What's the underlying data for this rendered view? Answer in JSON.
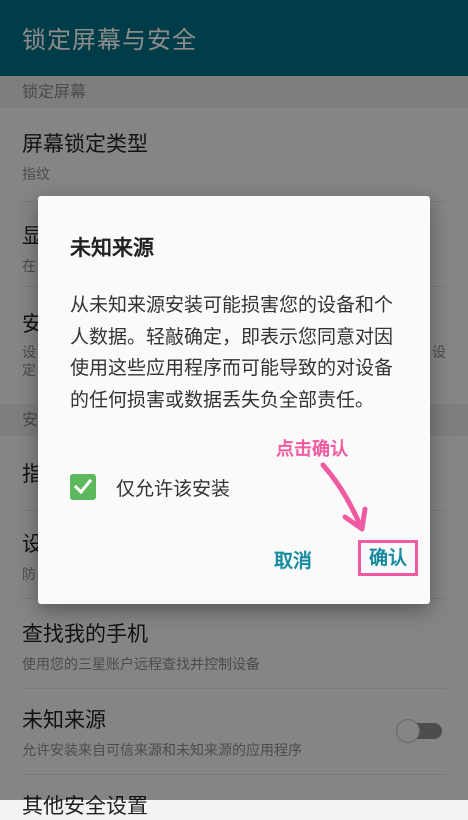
{
  "appbar": {
    "title": "锁定屏幕与安全"
  },
  "settings": {
    "section_lock": "锁定屏幕",
    "screen_lock_type": {
      "title": "屏幕锁定类型",
      "subtitle": "指纹"
    },
    "partial_items": [
      {
        "title": "显",
        "subtitle": "在"
      },
      {
        "title": "安",
        "subtitle": "设\n定"
      }
    ],
    "partial_right_char": "设",
    "section_security": "安",
    "partial_fingerprint": "指",
    "partial_setting": {
      "title": "设",
      "subtitle": "防"
    },
    "find_my_phone": {
      "title": "查找我的手机",
      "subtitle": "使用您的三星账户远程查找并控制设备"
    },
    "unknown_sources": {
      "title": "未知来源",
      "subtitle": "允许安装来自可信来源和未知来源的应用程序",
      "enabled": false
    },
    "bottom_partial": "其他安全设置"
  },
  "dialog": {
    "title": "未知来源",
    "message": "从未知来源安装可能损害您的设备和个人数据。轻敲确定，即表示您同意对因使用这些应用程序而可能导致的对设备的任何损害或数据丢失负全部责任。",
    "checkbox_label": "仅允许该安装",
    "checkbox_checked": true,
    "cancel_label": "取消",
    "confirm_label": "确认"
  },
  "annotation": {
    "text": "点击确认",
    "color": "#f05aa0"
  },
  "colors": {
    "appbar": "#036f83",
    "accent": "#168ba0",
    "check": "#5cb85c",
    "annotation": "#f05aa0"
  }
}
